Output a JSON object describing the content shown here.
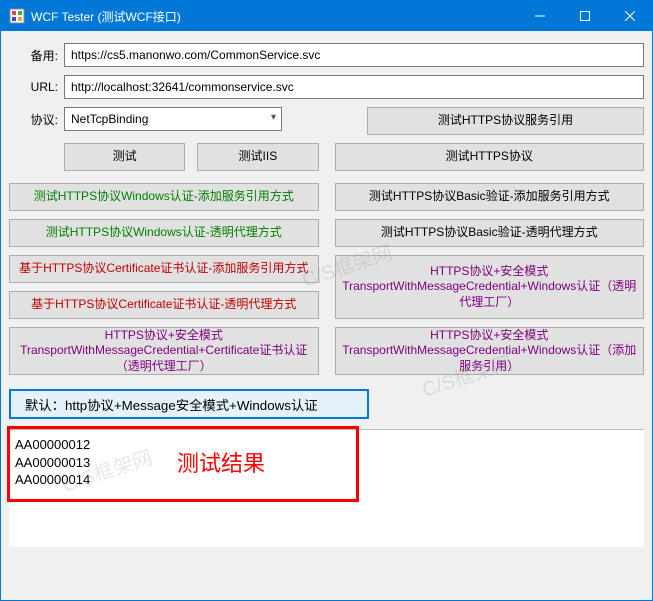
{
  "window": {
    "title": "WCF Tester (测试WCF接口)"
  },
  "fields": {
    "backup_label": "备用:",
    "backup_value": "https://cs5.manonwo.com/CommonService.svc",
    "url_label": "URL:",
    "url_value": "http://localhost:32641/commonservice.svc",
    "protocol_label": "协议:",
    "protocol_value": "NetTcpBinding"
  },
  "buttons": {
    "test_https_ref": "测试HTTPS协议服务引用",
    "test": "测试",
    "test_iis": "测试IIS",
    "test_https": "测试HTTPS协议",
    "https_win_add": "测试HTTPS协议Windows认证-添加服务引用方式",
    "https_basic_add": "测试HTTPS协议Basic验证-添加服务引用方式",
    "https_win_proxy": "测试HTTPS协议Windows认证-透明代理方式",
    "https_basic_proxy": "测试HTTPS协议Basic验证-透明代理方式",
    "https_cert_add": "基于HTTPS协议Certificate证书认证-添加服务引用方式",
    "https_sec_win_proxy": "HTTPS协议+安全模式TransportWithMessageCredential+Windows认证（透明代理工厂）",
    "https_cert_proxy": "基于HTTPS协议Certificate证书认证-透明代理方式",
    "https_sec_cert_proxy": "HTTPS协议+安全模式TransportWithMessageCredential+Certificate证书认证（透明代理工厂）",
    "https_sec_win_add": "HTTPS协议+安全模式TransportWithMessageCredential+Windows认证（添加服务引用）",
    "default": "默认：http协议+Message安全模式+Windows认证"
  },
  "results": {
    "label": "测试结果",
    "lines": [
      "AA00000012",
      "AA00000013",
      "AA00000014"
    ]
  },
  "watermark": "C/S框架网"
}
